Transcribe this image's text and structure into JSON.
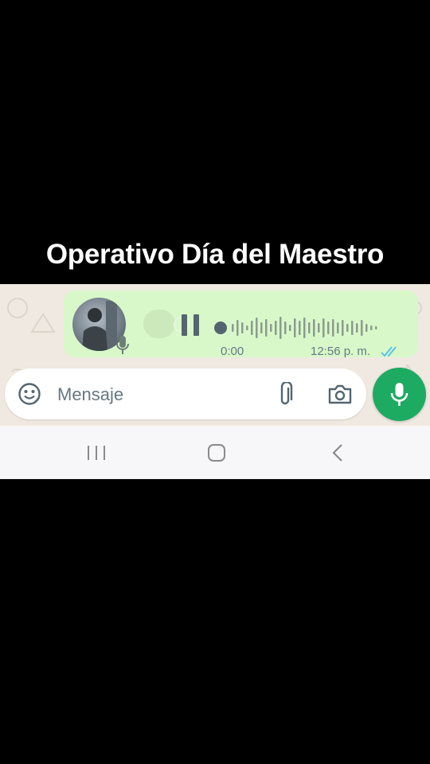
{
  "caption": {
    "text": "Operativo Día del Maestro"
  },
  "voice_message": {
    "duration": "0:00",
    "timestamp": "12:56 p. m.",
    "status": "read",
    "playing": true,
    "colors": {
      "bubble": "#d9f8c9",
      "ticks": "#53bdeb",
      "waveform": "#8b9b90",
      "played_dot": "#54656f"
    }
  },
  "composer": {
    "placeholder": "Mensaje",
    "icons": [
      "emoji-icon",
      "attach-icon",
      "camera-icon",
      "mic-icon"
    ],
    "send_button_color": "#1daa61"
  },
  "system_nav": {
    "icons": [
      "recents-icon",
      "home-icon",
      "back-icon"
    ]
  }
}
